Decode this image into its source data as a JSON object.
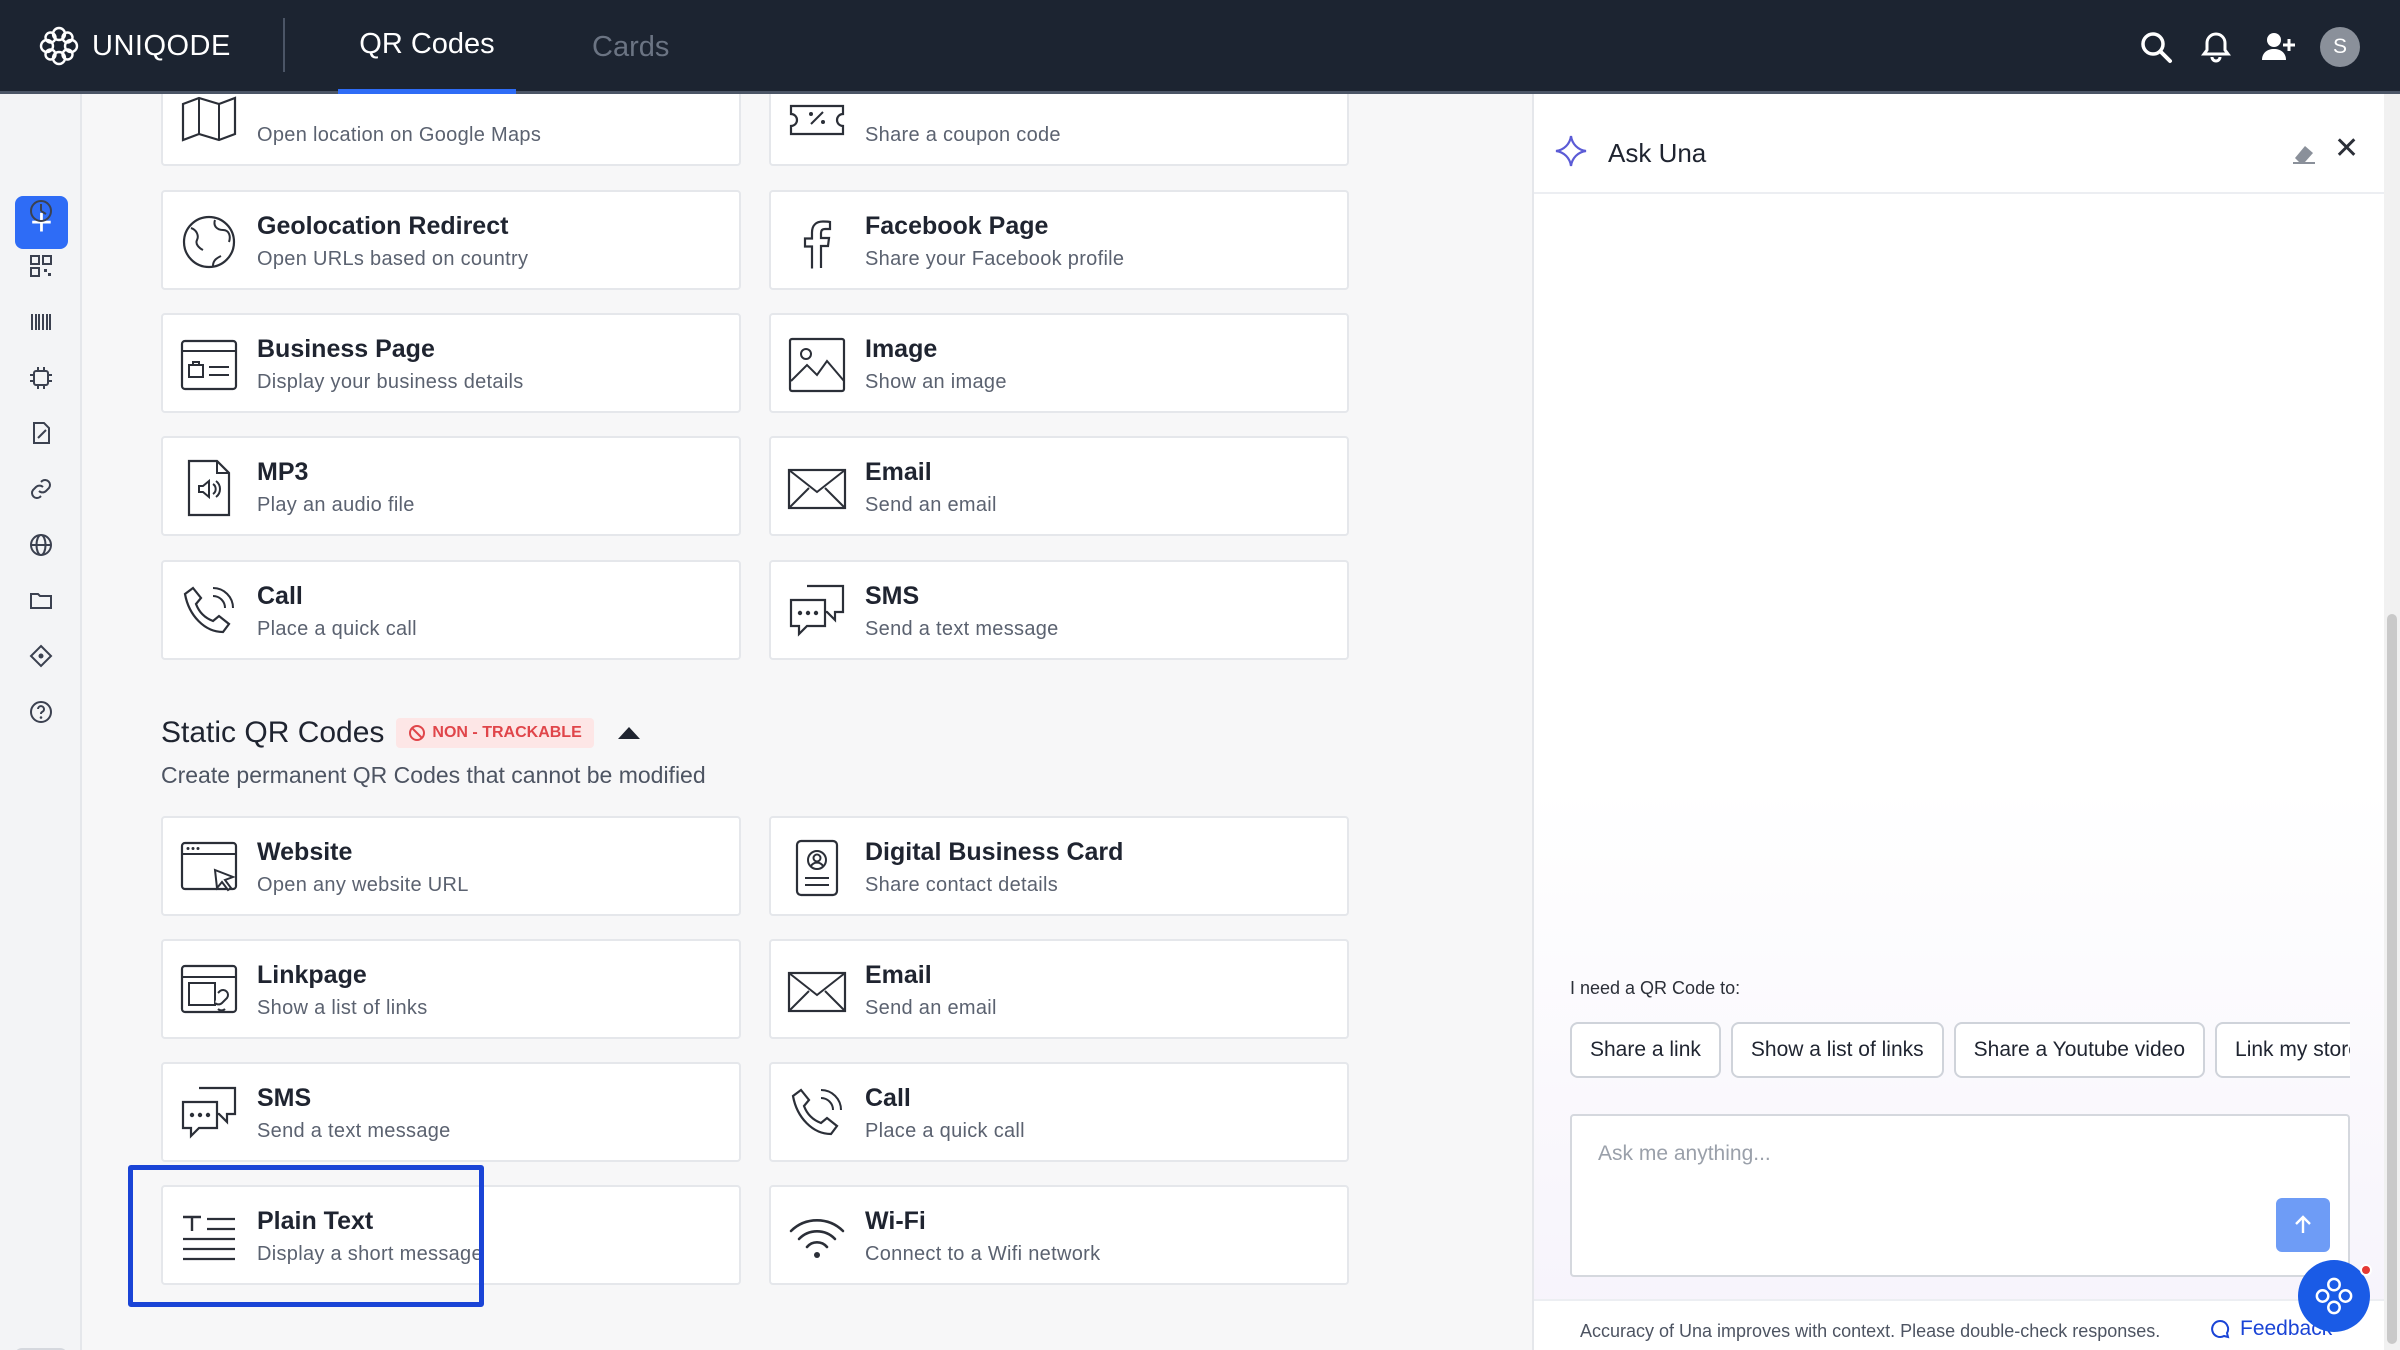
{
  "brand": {
    "name": "UNIQODE"
  },
  "nav": {
    "tabs": [
      {
        "label": "QR Codes",
        "active": true
      },
      {
        "label": "Cards",
        "active": false
      }
    ]
  },
  "user": {
    "initial": "S"
  },
  "rail": {
    "create_label": "+"
  },
  "dynamic_cards": [
    {
      "title": "",
      "desc": "Open location on Google Maps",
      "icon": "map-icon"
    },
    {
      "title": "",
      "desc": "Share a coupon code",
      "icon": "coupon-icon"
    },
    {
      "title": "Geolocation Redirect",
      "desc": "Open URLs based on country",
      "icon": "globe-icon"
    },
    {
      "title": "Facebook Page",
      "desc": "Share your Facebook profile",
      "icon": "facebook-icon"
    },
    {
      "title": "Business Page",
      "desc": "Display your business details",
      "icon": "business-icon"
    },
    {
      "title": "Image",
      "desc": "Show an image",
      "icon": "image-icon"
    },
    {
      "title": "MP3",
      "desc": "Play an audio file",
      "icon": "audio-file-icon"
    },
    {
      "title": "Email",
      "desc": "Send an email",
      "icon": "envelope-icon"
    },
    {
      "title": "Call",
      "desc": "Place a quick call",
      "icon": "phone-icon"
    },
    {
      "title": "SMS",
      "desc": "Send a text message",
      "icon": "sms-icon"
    }
  ],
  "static_section": {
    "title": "Static QR Codes",
    "badge": "NON - TRACKABLE",
    "subtitle": "Create permanent QR Codes that cannot be modified"
  },
  "static_cards": [
    {
      "title": "Website",
      "desc": "Open any website URL",
      "icon": "website-icon"
    },
    {
      "title": "Digital Business Card",
      "desc": "Share contact details",
      "icon": "contact-card-icon"
    },
    {
      "title": "Linkpage",
      "desc": "Show a list of links",
      "icon": "linkpage-icon"
    },
    {
      "title": "Email",
      "desc": "Send an email",
      "icon": "envelope-icon"
    },
    {
      "title": "SMS",
      "desc": "Send a text message",
      "icon": "sms-icon"
    },
    {
      "title": "Call",
      "desc": "Place a quick call",
      "icon": "phone-icon"
    },
    {
      "title": "Plain Text",
      "desc": "Display a short message",
      "icon": "text-icon"
    },
    {
      "title": "Wi-Fi",
      "desc": "Connect to a Wifi network",
      "icon": "wifi-icon"
    }
  ],
  "una": {
    "title": "Ask Una",
    "prompt": "I need a QR Code to:",
    "chips": [
      "Share a link",
      "Show a list of links",
      "Share a Youtube video",
      "Link my store"
    ],
    "input_placeholder": "Ask me anything...",
    "disclaimer": "Accuracy of Una improves with context. Please double-check responses.",
    "feedback": "Feedback"
  },
  "colors": {
    "nav_bg": "#1c2431",
    "accent": "#2e6cf6",
    "highlight": "#1a44d6",
    "badge_red": "#e0454a"
  }
}
